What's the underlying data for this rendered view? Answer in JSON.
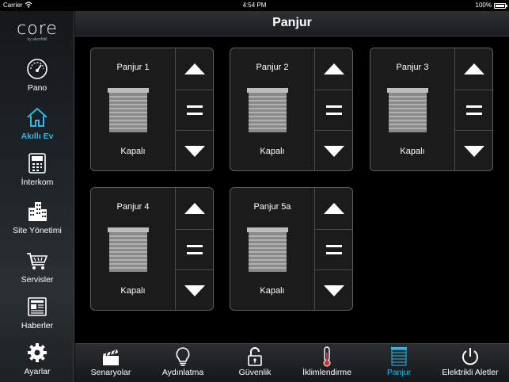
{
  "status_bar": {
    "carrier": "Carrier",
    "time": "4:54 PM",
    "battery": "100%"
  },
  "brand": {
    "name": "core",
    "sub": "by aksoftdil"
  },
  "sidebar": {
    "items": [
      {
        "label": "Pano",
        "icon": "gauge-icon"
      },
      {
        "label": "Akıllı Ev",
        "icon": "home-icon",
        "active": true
      },
      {
        "label": "İnterkom",
        "icon": "intercom-icon"
      },
      {
        "label": "Site Yönetimi",
        "icon": "buildings-icon"
      },
      {
        "label": "Servisler",
        "icon": "cart-icon"
      },
      {
        "label": "Haberler",
        "icon": "newspaper-icon"
      },
      {
        "label": "Ayarlar",
        "icon": "gear-icon"
      }
    ]
  },
  "header": {
    "title": "Panjur"
  },
  "shutters": [
    {
      "name": "Panjur 1",
      "status": "Kapalı"
    },
    {
      "name": "Panjur 2",
      "status": "Kapalı"
    },
    {
      "name": "Panjur 3",
      "status": "Kapalı"
    },
    {
      "name": "Panjur 4",
      "status": "Kapalı"
    },
    {
      "name": "Panjur 5a",
      "status": "Kapalı"
    }
  ],
  "tabs": [
    {
      "label": "Senaryolar",
      "icon": "clapperboard-icon"
    },
    {
      "label": "Aydınlatma",
      "icon": "lightbulb-icon"
    },
    {
      "label": "Güvenlik",
      "icon": "unlock-icon"
    },
    {
      "label": "İklimlendirme",
      "icon": "thermometer-icon"
    },
    {
      "label": "Panjur",
      "icon": "shutter-icon",
      "active": true
    },
    {
      "label": "Elektrikli Aletler",
      "icon": "power-icon"
    }
  ],
  "colors": {
    "accent": "#2fb8e8",
    "card_bg": "#1b1b1c",
    "card_border": "#5a5e62"
  }
}
